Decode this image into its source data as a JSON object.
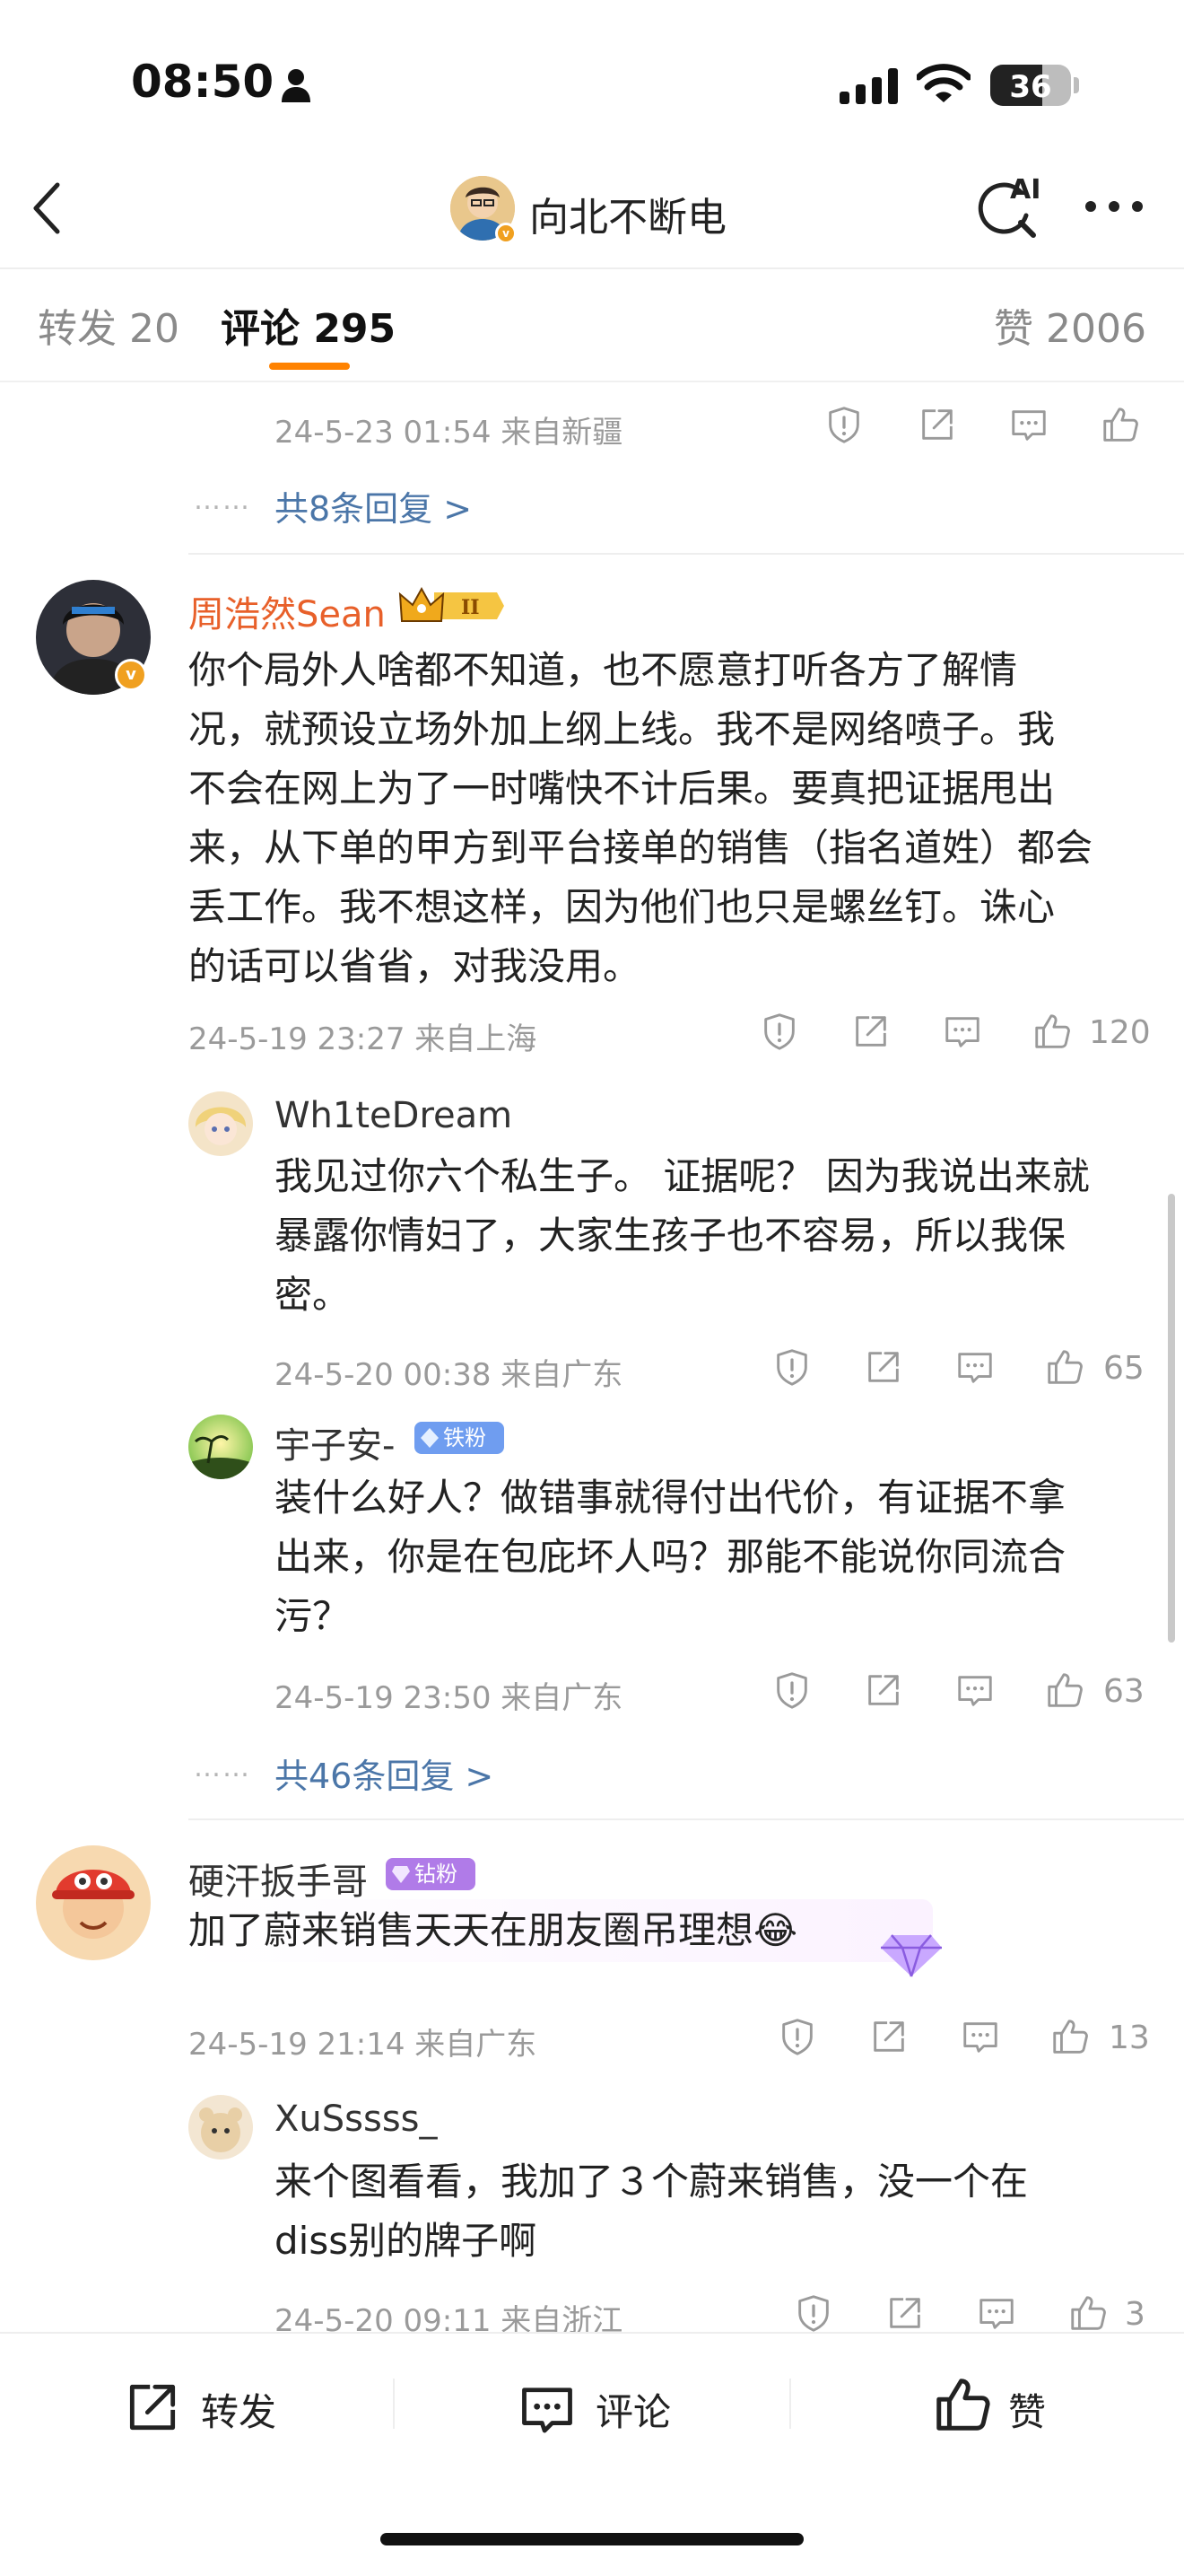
{
  "status_bar": {
    "time": "08:50",
    "battery": "36"
  },
  "nav": {
    "title": "向北不断电",
    "ai_label": "AI"
  },
  "tabs": {
    "repost": "转发 20",
    "comments": "评论 295",
    "likes": "赞 2006"
  },
  "top_item": {
    "meta": "24-5-23 01:54 来自新疆",
    "more_dots": "……",
    "more_replies": "共8条回复 >"
  },
  "comments": [
    {
      "user": "周浩然Sean",
      "text": [
        "你个局外人啥都不知道，也不愿意打听各方了解情",
        "况，就预设立场外加上纲上线。我不是网络喷子。我",
        "不会在网上为了一时嘴快不计后果。要真把证据甩出",
        "来，从下单的甲方到平台接单的销售（指名道姓）都会",
        "丢工作。我不想这样，因为他们也只是螺丝钉。诛心",
        "的话可以省省，对我没用。"
      ],
      "meta": "24-5-19 23:27 来自上海",
      "likes": "120",
      "replies": [
        {
          "user": "Wh1teDream",
          "text": [
            "我见过你六个私生子。 证据呢？ 因为我说出来就",
            "暴露你情妇了，大家生孩子也不容易，所以我保",
            "密。"
          ],
          "meta": "24-5-20 00:38 来自广东",
          "likes": "65"
        },
        {
          "user": "宇子安-",
          "badge": "铁粉5",
          "text": [
            "装什么好人？做错事就得付出代价，有证据不拿",
            "出来，你是在包庇坏人吗？那能不能说你同流合",
            "污？"
          ],
          "meta": "24-5-19 23:50 来自广东",
          "likes": "63"
        }
      ],
      "more_replies": "共46条回复 >"
    },
    {
      "user": "硬汗扳手哥",
      "badge": "钻粉2",
      "text": [
        "加了蔚来销售天天在朋友圈吊理想😂"
      ],
      "meta": "24-5-19 21:14 来自广东",
      "likes": "13",
      "replies": [
        {
          "user": "XuSssss_",
          "text": [
            "来个图看看，我加了３个蔚来销售，没一个在",
            "diss别的牌子啊"
          ],
          "meta": "24-5-20 09:11 来自浙江",
          "likes": "3"
        }
      ]
    }
  ],
  "bottom_bar": {
    "repost": "转发",
    "comment": "评论",
    "like": "赞"
  },
  "colors": {
    "accent": "#ff8200",
    "link": "#4b76a8",
    "vip_name": "#e8602a"
  }
}
